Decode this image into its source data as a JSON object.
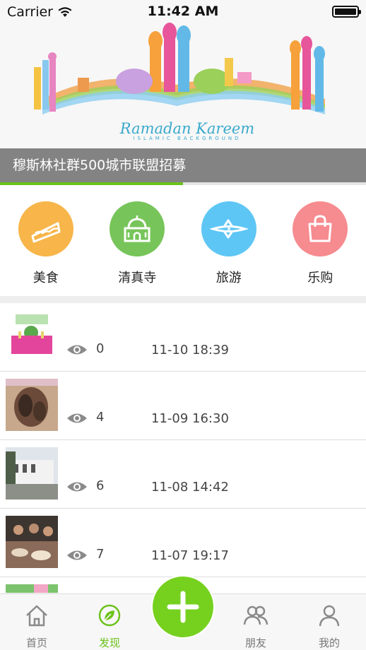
{
  "status_bar": {
    "carrier": "Carrier",
    "time": "11:42 AM"
  },
  "banner": {
    "caption": "穆斯林社群500城市联盟招募",
    "art_title": "Ramadan Kareem",
    "art_subtitle": "ISLAMIC BACKGROUND",
    "progress": 0.5,
    "accent_color": "#6cc21b"
  },
  "categories": [
    {
      "label": "美食",
      "icon": "cake-icon",
      "color": "#f7b54a"
    },
    {
      "label": "清真寺",
      "icon": "mosque-icon",
      "color": "#77c55a"
    },
    {
      "label": "旅游",
      "icon": "airplane-icon",
      "color": "#5ec6f5"
    },
    {
      "label": "乐购",
      "icon": "shopping-bag-icon",
      "color": "#f68b90"
    }
  ],
  "posts": [
    {
      "views": "0",
      "time": "11-10 18:39"
    },
    {
      "views": "4",
      "time": "11-09 16:30"
    },
    {
      "views": "6",
      "time": "11-08 14:42"
    },
    {
      "views": "7",
      "time": "11-07 19:17"
    }
  ],
  "tabbar": {
    "items": [
      {
        "label": "首页",
        "icon": "home-icon"
      },
      {
        "label": "发现",
        "icon": "leaf-icon",
        "active": true
      },
      {
        "label": "朋友",
        "icon": "friends-icon"
      },
      {
        "label": "我的",
        "icon": "profile-icon"
      }
    ],
    "fab_icon": "plus-icon"
  }
}
